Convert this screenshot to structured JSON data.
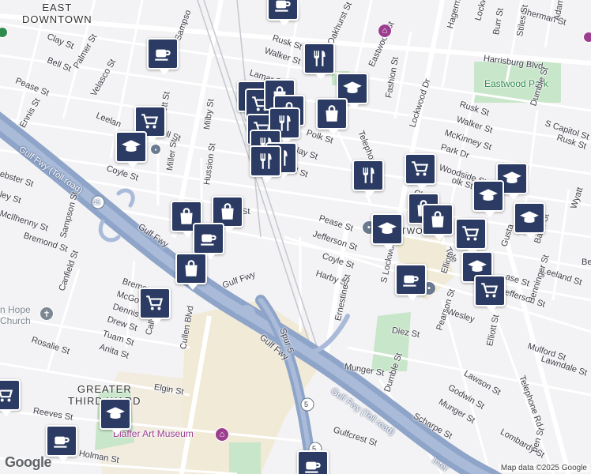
{
  "map": {
    "attribution": "Map data ©2025 Google",
    "logo": "Google",
    "areas": {
      "east_downtown": "EAST\nDOWNTOWN",
      "greater_third_ward": "GREATER\nTHIRD WARD",
      "eastwood": "EASTWOOD"
    },
    "parks": {
      "eastwood_park": "Eastwood Park"
    },
    "places": {
      "blaffer": "Blaffer Art Museum",
      "hope_church_1": "n Hope",
      "hope_church_2": "Church"
    },
    "streets": {
      "clay_w": "Clay St",
      "bell_w": "Bell St",
      "palmer": "Palmer St",
      "velasco": "Velasco St",
      "pease_w": "Pease St",
      "ennis": "Ennis St",
      "leeland_w": "Leelan",
      "scott": "Scott St",
      "sampson_n": "Sampso",
      "rusk_n": "Rusk St",
      "walker_n": "Walker St",
      "lamar": "Lamar St",
      "oakhurst": "Oakhurst St",
      "eastwood_st": "Eastwood St",
      "fashion": "Fashion St",
      "harrisburg": "Harrisburg Blvd",
      "hagerman": "Hagerman",
      "lockwood_n": "Lockwo",
      "sherman": "Sherman St",
      "burr": "Burr St",
      "stiles": "Stiles St",
      "adams": "Adams",
      "rusk_e": "Rusk St",
      "walker_e": "Walker St",
      "mckinney": "McKinney St",
      "dumble_n": "Dumble St",
      "s_capitol": "S Capitol St",
      "rusk_e2": "Rusk St",
      "park_dr": "Park Dr",
      "woodside": "Woodside St",
      "lockwood_dr": "Lockwood Dr",
      "telephone_n": "Telephone Rd",
      "polk": "Polk St",
      "clay_c": "Clay St",
      "bell_c": "ell St",
      "bell_w2": "Bell St",
      "milby": "Milby St",
      "coyle_w": "Coyle St",
      "miller": "Miller St",
      "hussion": "Hussion St",
      "webster": "ebster St",
      "ley": "ley St",
      "mcilhenny": "McIlhenny St",
      "sampson_s": "Sampson St",
      "bremond": "Bremond St",
      "gulf_fwy_toll_w": "Gulf Fwy (Toll road)",
      "gulf_fwy_w": "Gulf Fwy",
      "i45": "45",
      "gulf_fwy_mid": "Gulf Fwy",
      "bremond_s": "Bremond St",
      "mcgo": "McGo",
      "dennis": "Dennis",
      "drew": "Drew St",
      "tuam": "Tuam St",
      "anita": "Anita St",
      "rosalie": "Rosalie St",
      "canfield": "Canfield St",
      "calli": "Calli",
      "cullen": "Cullen Blvd",
      "gulf_fwy_c": "Gulf Fwy",
      "spur5": "Spur 5",
      "elgin": "Elgin St",
      "reeves": "Reeves St",
      "holman": "Holman St",
      "st_c": "St",
      "pease_c": "Pease St",
      "jefferson_c": "Jefferson St",
      "coyle_c": "Coyle St",
      "harby": "Harby St",
      "ernestine": "Ernestine St",
      "s_lockwood": "S Lockwood Dr",
      "clay_e": "Clay",
      "polk_e": "olk St",
      "wyatt": "Wyatt",
      "gusta": "Gusta",
      "baird": "Baird St",
      "tele_e": "Tele",
      "leeland_e": "Leeland St",
      "elliott_n": "Elliott",
      "pease_e": "ase St",
      "jefferson_e": "Jefferson St",
      "wesley": "Wesley",
      "henninger": "Henninger St",
      "diez": "Diez St",
      "pearson": "Pearson St",
      "elliott_s": "Elliott St",
      "telephone_s": "Telephone Rd",
      "mulford": "Mulford St",
      "lawndale": "Lawndale St",
      "munger_w": "Munger St",
      "lawson": "Lawson St",
      "godwin": "Godwin St",
      "munger_e": "Munger St",
      "dumble_s": "Dumble St",
      "scharpe": "Scharpe St",
      "gulf_fwy_toll_e": "Gulf Fwy (Toll road)",
      "gulfcrest": "Gulfcrest St",
      "lombardy": "Lombardy St",
      "jensen": "pen St",
      "inter": "Inter",
      "be": "Be",
      "i5": "5",
      "i5b": "5"
    },
    "pins": [
      {
        "type": "cafe-icon"
      },
      {
        "type": "cafe-icon"
      },
      {
        "type": "shopping-cart-icon"
      },
      {
        "type": "school-icon"
      },
      {
        "type": "restaurant-icon"
      },
      {
        "type": "restaurant-icon"
      },
      {
        "type": "shopping-cart-icon"
      },
      {
        "type": "shopping-bag-icon"
      },
      {
        "type": "school-icon"
      },
      {
        "type": "shopping-bag-icon"
      },
      {
        "type": "shopping-bag-icon"
      },
      {
        "type": "shopping-cart-icon"
      },
      {
        "type": "restaurant-icon"
      },
      {
        "type": "restaurant-icon"
      },
      {
        "type": "restaurant-icon"
      },
      {
        "type": "restaurant-icon"
      },
      {
        "type": "restaurant-icon"
      },
      {
        "type": "shopping-cart-icon"
      },
      {
        "type": "school-icon"
      },
      {
        "type": "school-icon"
      },
      {
        "type": "shopping-bag-icon"
      },
      {
        "type": "shopping-bag-icon"
      },
      {
        "type": "cafe-icon"
      },
      {
        "type": "shopping-bag-icon"
      },
      {
        "type": "shopping-cart-icon"
      },
      {
        "type": "school-icon"
      },
      {
        "type": "shopping-bag-icon"
      },
      {
        "type": "shopping-bag-icon"
      },
      {
        "type": "shopping-cart-icon"
      },
      {
        "type": "school-icon"
      },
      {
        "type": "school-icon"
      },
      {
        "type": "cafe-icon"
      },
      {
        "type": "shopping-cart-icon"
      },
      {
        "type": "school-icon"
      },
      {
        "type": "cafe-icon"
      },
      {
        "type": "cafe-icon"
      },
      {
        "type": "shopping-cart-icon"
      }
    ],
    "colors": {
      "pin": "#2b3b63",
      "freeway": "#8ea4c8",
      "park": "#c8e6c9",
      "campus": "#f1ead6",
      "museum_poi": "#9c3e8f",
      "transit_poi": "#6b7a8f",
      "church_poi": "#7d8894"
    }
  }
}
